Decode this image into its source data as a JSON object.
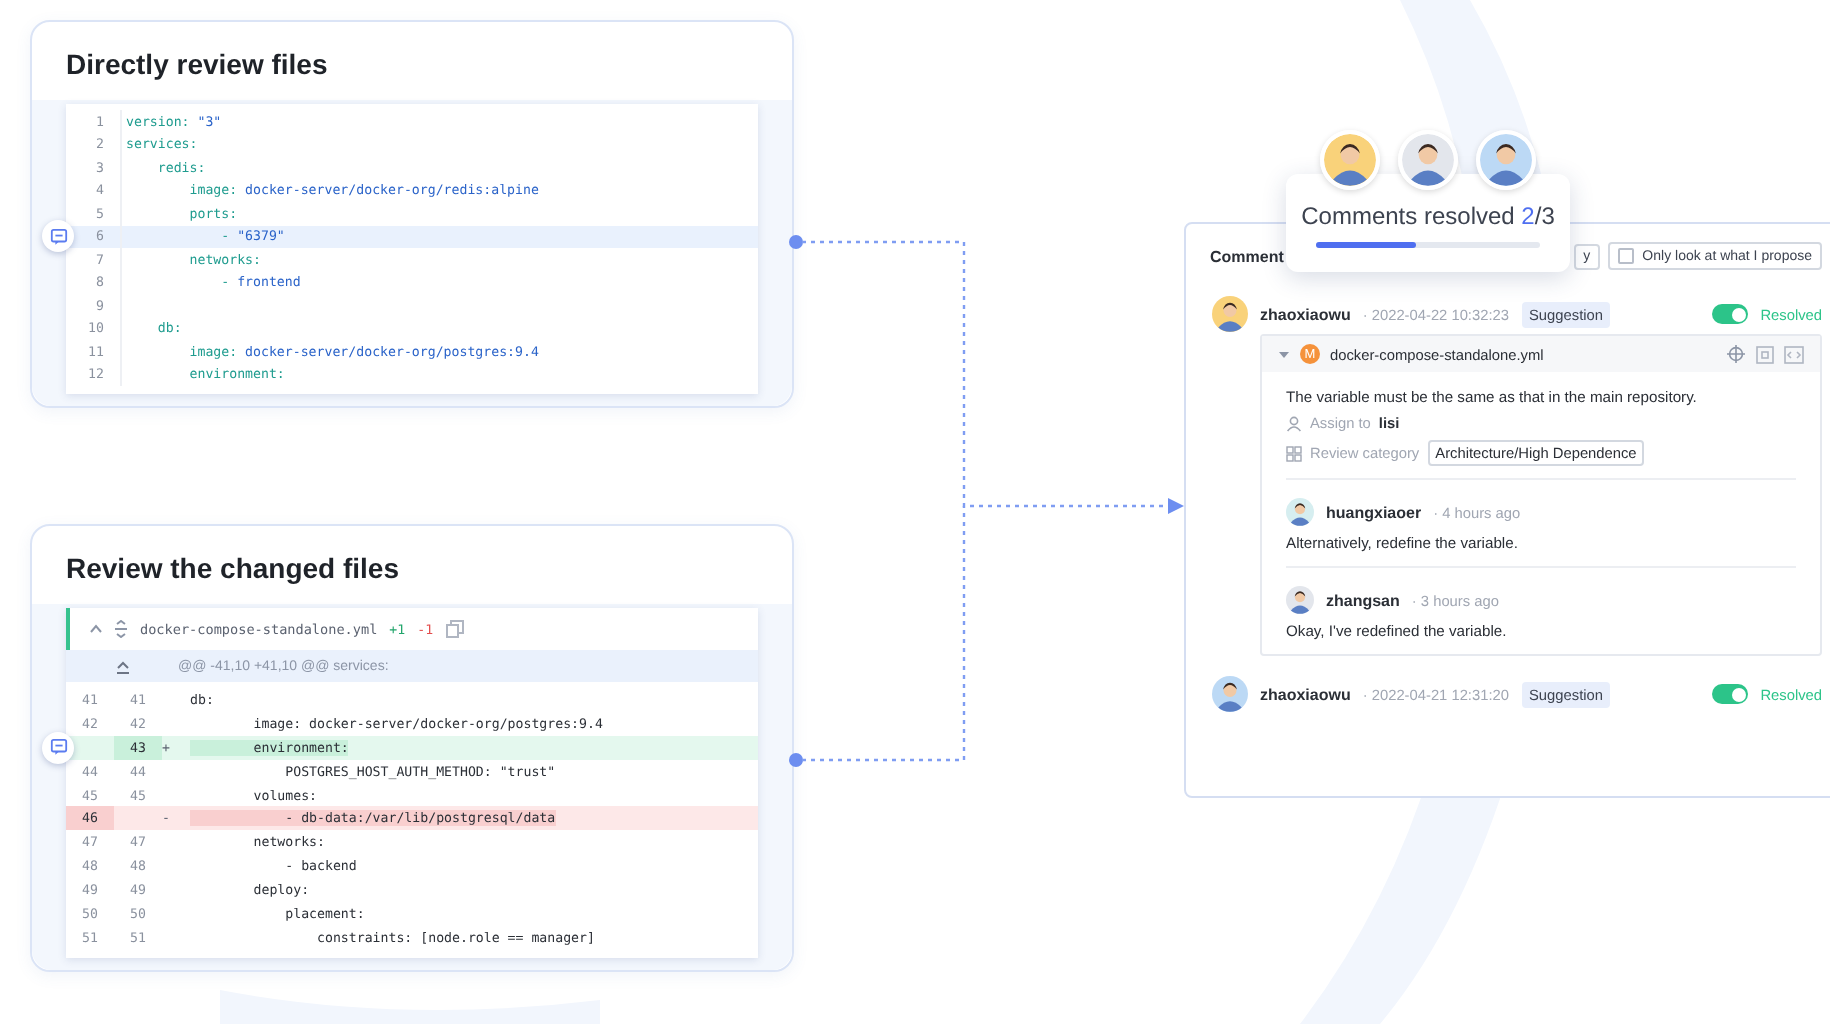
{
  "file_card": {
    "title": "Directly review files",
    "lines": [
      {
        "num": "1",
        "key": "version:",
        "value": " \"3\"",
        "commented": false
      },
      {
        "num": "2",
        "key": "services:",
        "commented": false
      },
      {
        "num": "3",
        "key": "    redis:",
        "commented": false
      },
      {
        "num": "4",
        "key": "        image:",
        "value": " docker-server/docker-org/redis:alpine",
        "commented": false
      },
      {
        "num": "5",
        "key": "        ports:",
        "commented": false
      },
      {
        "num": "6",
        "key": "            -",
        "value": " \"6379\"",
        "commented": true
      },
      {
        "num": "7",
        "key": "        networks:",
        "commented": false
      },
      {
        "num": "8",
        "key": "            -",
        "value": " frontend",
        "commented": false
      },
      {
        "num": "9",
        "commented": false
      },
      {
        "num": "10",
        "key": "    db:",
        "commented": false
      },
      {
        "num": "11",
        "key": "        image:",
        "value": " docker-server/docker-org/postgres:9.4",
        "commented": false
      },
      {
        "num": "12",
        "key": "        environment:",
        "commented": false
      }
    ]
  },
  "diff_card": {
    "title": "Review the changed files",
    "file_name": "docker-compose-standalone.yml",
    "added": "+1",
    "removed": "-1",
    "hunk": "@@ -41,10 +41,10 @@ services:",
    "lines": [
      {
        "old": "41",
        "new": "41",
        "kind": "context",
        "text": "db:",
        "commented": false
      },
      {
        "old": "42",
        "new": "42",
        "kind": "context",
        "text": "        image: docker-server/docker-org/postgres:9.4",
        "commented": false
      },
      {
        "new": "43",
        "kind": "add",
        "sign": "+",
        "text": "        environment:",
        "commented": true
      },
      {
        "old": "44",
        "new": "44",
        "kind": "context",
        "text": "            POSTGRES_HOST_AUTH_METHOD: \"trust\"",
        "commented": false
      },
      {
        "old": "45",
        "new": "45",
        "kind": "context",
        "text": "        volumes:",
        "commented": false
      },
      {
        "old": "46",
        "kind": "del",
        "sign": "-",
        "text": "            - db-data:/var/lib/postgresql/data",
        "commented": false
      },
      {
        "old": "47",
        "new": "47",
        "kind": "context",
        "text": "        networks:",
        "commented": false
      },
      {
        "old": "48",
        "new": "48",
        "kind": "context",
        "text": "            - backend",
        "commented": false
      },
      {
        "old": "49",
        "new": "49",
        "kind": "context",
        "text": "        deploy:",
        "commented": false
      },
      {
        "old": "50",
        "new": "50",
        "kind": "context",
        "text": "            placement:",
        "commented": false
      },
      {
        "old": "51",
        "new": "51",
        "kind": "context",
        "text": "                constraints: [node.role == manager]",
        "commented": false
      }
    ]
  },
  "resolved_popup": {
    "label": "Comments resolved ",
    "resolved": "2",
    "total": "/3",
    "level": 0.45,
    "avatars": [
      {
        "color": "#f9d27a"
      },
      {
        "color": "#e3e6ec"
      },
      {
        "color": "#bcd9f5"
      }
    ]
  },
  "comments_panel": {
    "title": "Comment",
    "filter_button": "y",
    "own_filter": {
      "label": "Only look at what I propose",
      "checked": false
    },
    "comments": [
      {
        "author": "zhaoxiaowu",
        "avatar": {
          "color": "#f9d27a"
        },
        "time": "· 2022-04-22 10:32:23",
        "tag": "Suggestion",
        "resolved": true,
        "resolved_label": "Resolved",
        "thread": {
          "file_badge": "M",
          "file_name": "docker-compose-standalone.yml",
          "text": "The variable must be the same as that in the main repository.",
          "assign_label": "Assign to",
          "assignee": "lisi",
          "category_label": "Review category",
          "category": "Architecture/High Dependence",
          "replies": [
            {
              "author": "huangxiaoer",
              "avatar": {
                "color": "#d6eef0"
              },
              "time": "· 4 hours ago",
              "text": "Alternatively, redefine the variable."
            },
            {
              "author": "zhangsan",
              "avatar": {
                "color": "#e3e6ec"
              },
              "time": "· 3 hours ago",
              "text": "Okay, I've redefined the variable."
            }
          ]
        }
      },
      {
        "author": "zhaoxiaowu",
        "avatar": {
          "color": "#bcd9f5"
        },
        "time": "· 2022-04-21 12:31:20",
        "tag": "Suggestion",
        "resolved": true,
        "resolved_label": "Resolved"
      }
    ]
  }
}
